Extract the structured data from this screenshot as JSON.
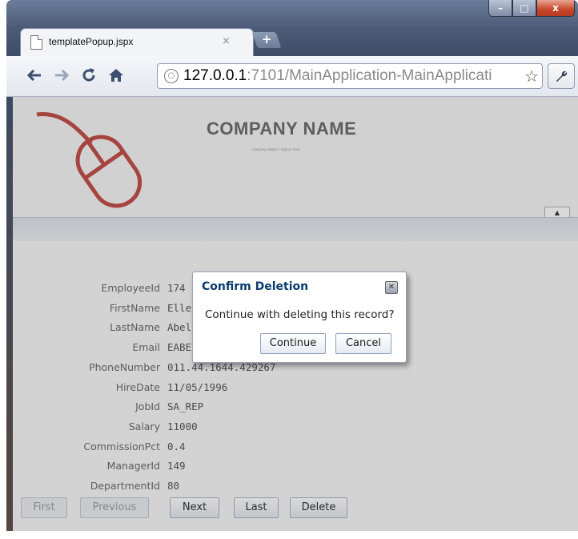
{
  "window": {
    "tab_title": "templatePopup.jspx",
    "tab_close": "×",
    "new_tab": "+",
    "minimize": "–",
    "maximize": "□",
    "close": "x"
  },
  "toolbar": {
    "url_host": "127.0.0.1",
    "url_path": ":7101/MainApplication-MainApplicati"
  },
  "header": {
    "company_name": "COMPANY NAME",
    "tagline": "company slogan / tagline here",
    "collapse_label": "▲"
  },
  "form": {
    "fields": [
      {
        "label": "EmployeeId",
        "value": "174"
      },
      {
        "label": "FirstName",
        "value": "Ellen"
      },
      {
        "label": "LastName",
        "value": "Abel"
      },
      {
        "label": "Email",
        "value": "EABEL"
      },
      {
        "label": "PhoneNumber",
        "value": "011.44.1644.429267"
      },
      {
        "label": "HireDate",
        "value": "11/05/1996"
      },
      {
        "label": "JobId",
        "value": "SA_REP"
      },
      {
        "label": "Salary",
        "value": "11000"
      },
      {
        "label": "CommissionPct",
        "value": "0.4"
      },
      {
        "label": "ManagerId",
        "value": "149"
      },
      {
        "label": "DepartmentId",
        "value": "80"
      }
    ],
    "buttons": {
      "first": "First",
      "previous": "Previous",
      "next": "Next",
      "last": "Last",
      "delete": "Delete"
    }
  },
  "dialog": {
    "title": "Confirm Deletion",
    "message": "Continue with deleting this record?",
    "continue_label": "Continue",
    "cancel_label": "Cancel"
  },
  "colors": {
    "logo": "#c4514b",
    "dialog_title": "#0a3b6e",
    "chrome_frame": "#4c5c78"
  }
}
